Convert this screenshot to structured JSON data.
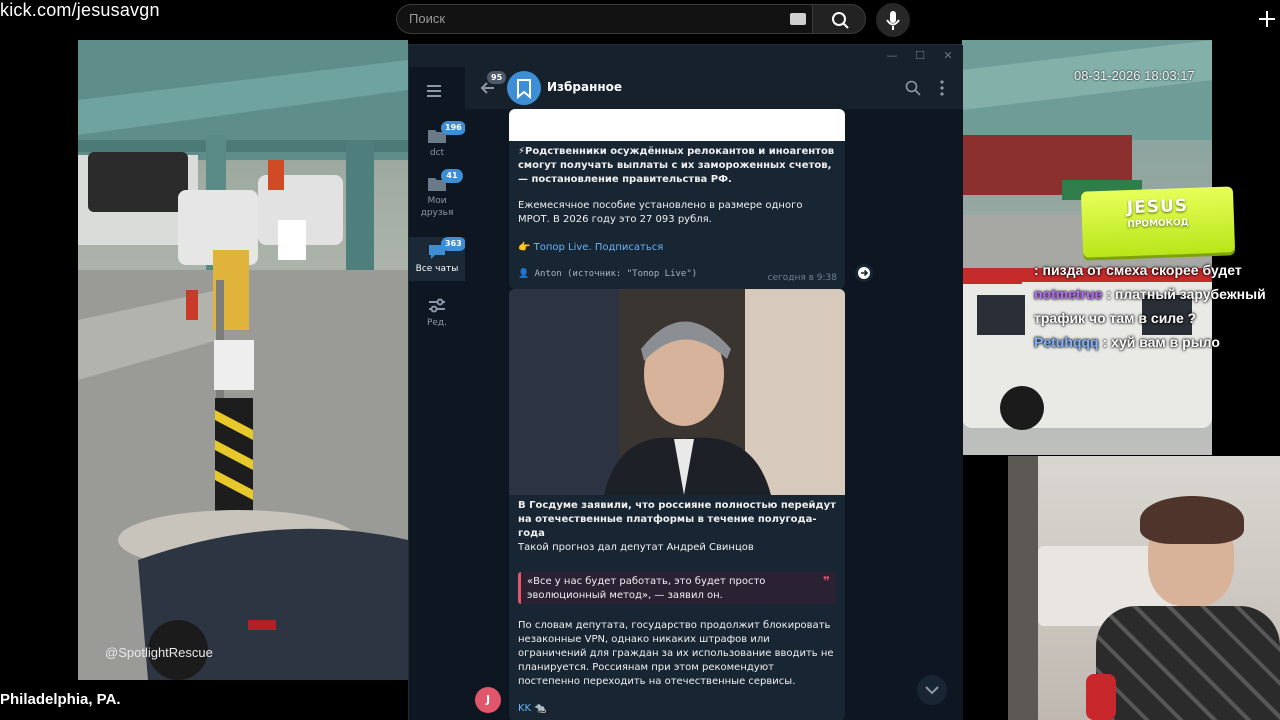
{
  "stream": {
    "url": "kick.com/jesusavgn",
    "search_placeholder": "Поиск",
    "timestamp": "08-31-2026 18:03:17",
    "watermark": "@SpotlightRescue",
    "location": "Philadelphia, PA."
  },
  "promo": {
    "title": "JESUS",
    "subtitle": "ПРОМОКОД"
  },
  "chat": [
    {
      "user": "",
      "text": ": пизда от смеха скорее будет",
      "user_color": "#ff4d4d"
    },
    {
      "user": "notmetrue",
      "text": ": платный зарубежный трафик чо там в силе ?",
      "user_color": "#b56bff"
    },
    {
      "user": "Petuhqqq",
      "text": ": хуй вам в рыло",
      "user_color": "#7fb2ff"
    }
  ],
  "telegram": {
    "window_controls": [
      "—",
      "☐",
      "✕"
    ],
    "folders": [
      {
        "label": "dct",
        "badge": "196",
        "badge_type": "blue"
      },
      {
        "label": "Мои друзья",
        "badge": "41",
        "badge_type": "blue"
      },
      {
        "label": "Все чаты",
        "badge": "363",
        "badge_type": "blue"
      },
      {
        "label": "Ред.",
        "badge": "",
        "badge_type": ""
      }
    ],
    "back_badge": "95",
    "chat_title": "Избранное",
    "messages": [
      {
        "headline": "⚡Родственники осуждённых релокантов и иноагентов смогут получать выплаты с их замороженных счетов, — постановление правительства РФ.",
        "body": "Ежемесячное пособие установлено в размере одного МРОТ. В 2026 году это 27 093 рубля.",
        "link": "👉 Топор Live. Подписаться",
        "author": "👤 Anton (источник: \"Топор Live\")",
        "time": "сегодня в 9:38"
      },
      {
        "headline": "В Госдуме заявили, что россияне полностью перейдут на отечественные платформы в течение полугода-года",
        "lead": "Такой прогноз дал депутат Андрей Свинцов",
        "quote": "«Все у нас будет работать, это будет просто эволюционный метод», — заявил он.",
        "body": "По словам депутата, государство продолжит блокировать незаконные VPN, однако никаких штрафов или ограничений для граждан за их использование вводить не планируется. Россиянам при этом рекомендуют постепенно переходить на отечественные сервисы."
      }
    ],
    "sender_initial": "J",
    "next_message_preview": "KK 🐀"
  }
}
